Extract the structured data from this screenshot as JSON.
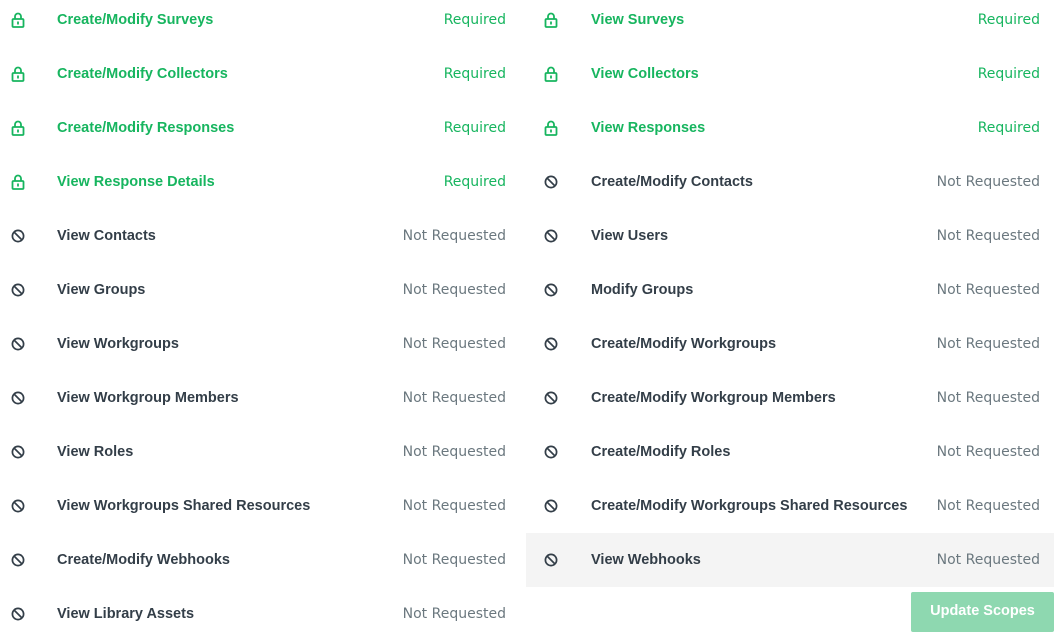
{
  "colors": {
    "required": "#17b55f",
    "not_requested_label": "#333e48",
    "status_grey": "#6b787f",
    "button": "#8ed8b0"
  },
  "left_scopes": [
    {
      "label": "Create/Modify Surveys",
      "status": "Required",
      "icon": "lock-icon"
    },
    {
      "label": "Create/Modify Collectors",
      "status": "Required",
      "icon": "lock-icon"
    },
    {
      "label": "Create/Modify Responses",
      "status": "Required",
      "icon": "lock-icon"
    },
    {
      "label": "View Response Details",
      "status": "Required",
      "icon": "lock-icon"
    },
    {
      "label": "View Contacts",
      "status": "Not Requested",
      "icon": "ban-icon"
    },
    {
      "label": "View Groups",
      "status": "Not Requested",
      "icon": "ban-icon"
    },
    {
      "label": "View Workgroups",
      "status": "Not Requested",
      "icon": "ban-icon"
    },
    {
      "label": "View Workgroup Members",
      "status": "Not Requested",
      "icon": "ban-icon"
    },
    {
      "label": "View Roles",
      "status": "Not Requested",
      "icon": "ban-icon"
    },
    {
      "label": "View Workgroups Shared Resources",
      "status": "Not Requested",
      "icon": "ban-icon"
    },
    {
      "label": "Create/Modify Webhooks",
      "status": "Not Requested",
      "icon": "ban-icon"
    },
    {
      "label": "View Library Assets",
      "status": "Not Requested",
      "icon": "ban-icon"
    }
  ],
  "right_scopes": [
    {
      "label": "View Surveys",
      "status": "Required",
      "icon": "lock-icon"
    },
    {
      "label": "View Collectors",
      "status": "Required",
      "icon": "lock-icon"
    },
    {
      "label": "View Responses",
      "status": "Required",
      "icon": "lock-icon"
    },
    {
      "label": "Create/Modify Contacts",
      "status": "Not Requested",
      "icon": "ban-icon"
    },
    {
      "label": "View Users",
      "status": "Not Requested",
      "icon": "ban-icon"
    },
    {
      "label": "Modify Groups",
      "status": "Not Requested",
      "icon": "ban-icon"
    },
    {
      "label": "Create/Modify Workgroups",
      "status": "Not Requested",
      "icon": "ban-icon"
    },
    {
      "label": "Create/Modify Workgroup Members",
      "status": "Not Requested",
      "icon": "ban-icon"
    },
    {
      "label": "Create/Modify Roles",
      "status": "Not Requested",
      "icon": "ban-icon"
    },
    {
      "label": "Create/Modify Workgroups Shared Resources",
      "status": "Not Requested",
      "icon": "ban-icon"
    },
    {
      "label": "View Webhooks",
      "status": "Not Requested",
      "icon": "ban-icon"
    }
  ],
  "update_button": {
    "label": "Update Scopes"
  }
}
